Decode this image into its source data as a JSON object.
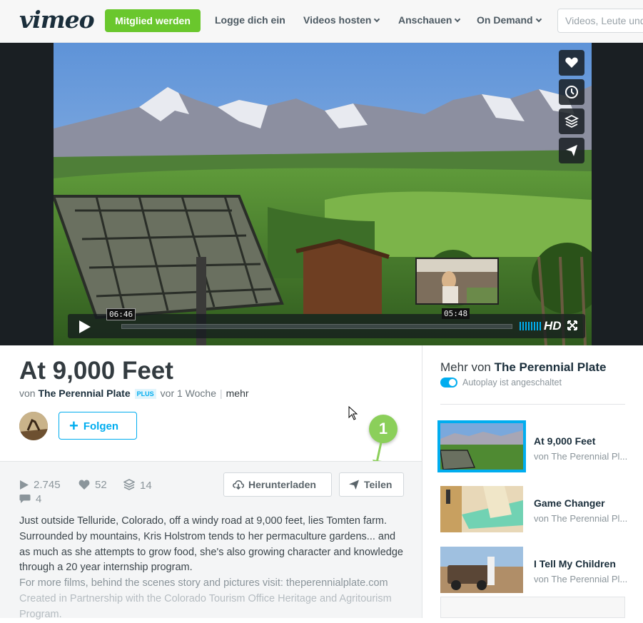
{
  "nav": {
    "logo": "vimeo",
    "join_label": "Mitglied werden",
    "login_label": "Logge dich ein",
    "host_label": "Videos hosten",
    "watch_label": "Anschauen",
    "ondemand_label": "On Demand",
    "search_placeholder": "Videos, Leute und mehr"
  },
  "player": {
    "time_hover": "06:46",
    "time_preview": "05:48",
    "quality": "HD"
  },
  "video": {
    "title": "At 9,000 Feet",
    "by_prefix": "von",
    "owner": "The Perennial Plate",
    "owner_badge": "PLUS",
    "age": "vor 1 Woche",
    "more_label": "mehr",
    "follow_label": "Folgen",
    "stats": {
      "plays": "2.745",
      "likes": "52",
      "collections": "14",
      "comments": "4"
    },
    "download_label": "Herunterladen",
    "share_label": "Teilen",
    "description": "Just outside Telluride, Colorado, off a windy road at 9,000 feet, lies Tomten farm. Surrounded by mountains, Kris Holstrom tends to her permaculture gardens... and as much as she attempts to grow food, she's also growing character and knowledge through a 20 year internship program.",
    "description_more": "For more films, behind the scenes story and pictures visit: theperennialplate.com",
    "description_faded": "Created in Partnership with the Colorado Tourism Office Heritage and Agritourism Program."
  },
  "annotation": {
    "badge": "1"
  },
  "sidebar": {
    "title_prefix": "Mehr von",
    "title_owner": "The Perennial Plate",
    "autoplay_label": "Autoplay ist angeschaltet",
    "items": [
      {
        "title": "At 9,000 Feet",
        "owner": "von The Perennial Pl..."
      },
      {
        "title": "Game Changer",
        "owner": "von The Perennial Pl..."
      },
      {
        "title": "I Tell My Children",
        "owner": "von The Perennial Pl..."
      }
    ]
  },
  "colors": {
    "accent": "#00adef",
    "join": "#6ac72d",
    "badge": "#8bcf5a",
    "text_dark": "#1a2e3b"
  }
}
